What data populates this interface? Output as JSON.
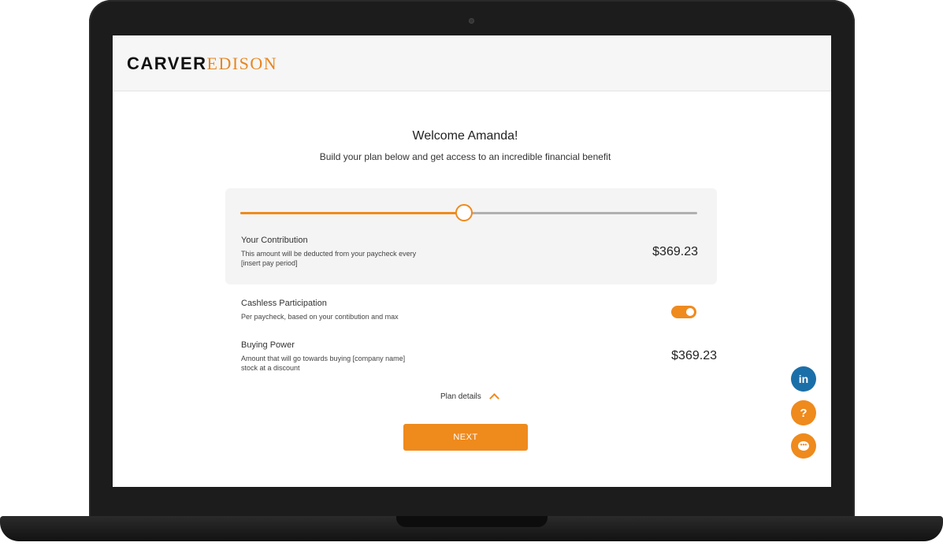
{
  "brand": {
    "name_part1": "CARVER",
    "name_part2": "EDISON",
    "accent_color": "#ef8a1d"
  },
  "welcome": {
    "title": "Welcome Amanda!",
    "subtitle": "Build your plan below and get access to an incredible financial benefit"
  },
  "slider": {
    "level": 0.49
  },
  "contribution": {
    "title": "Your Contribution",
    "desc_line1": "This amount will be deducted from your paycheck every",
    "desc_line2": "[insert pay period]",
    "amount": "$369.23"
  },
  "cashless": {
    "title": "Cashless Participation",
    "desc": "Per paycheck, based on your contibution and max",
    "enabled": true
  },
  "buying_power": {
    "title": "Buying Power",
    "desc_line1": "Amount that will go towards buying [company name]",
    "desc_line2": "stock at a discount",
    "amount": "$369.23"
  },
  "plan_details": {
    "label": "Plan details",
    "icon": "chevron-up-icon"
  },
  "next_button": {
    "label": "NEXT"
  },
  "floating_actions": {
    "linkedin_label": "in",
    "help_label": "?",
    "chat_dots": "•••"
  }
}
